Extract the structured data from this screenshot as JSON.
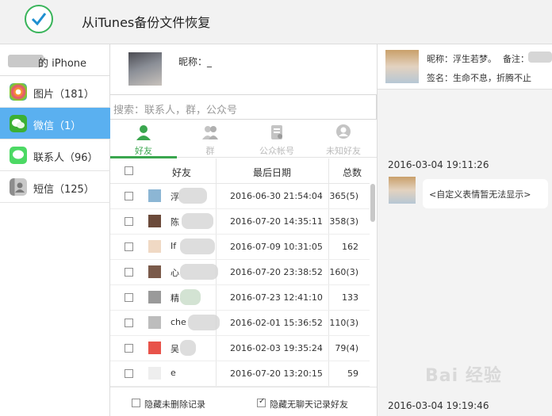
{
  "app": {
    "title": "从iTunes备份文件恢复",
    "icon": "check-logo-icon",
    "accent": "#39b45a"
  },
  "sidebar": {
    "device_label": "的 iPhone",
    "items": [
      {
        "label": "图片（181）",
        "icon": "photos-icon",
        "color": "#f5a623"
      },
      {
        "label": "微信（1）",
        "icon": "wechat-icon",
        "color": "#3cb034",
        "active": true
      },
      {
        "label": "联系人（96）",
        "icon": "messages-icon",
        "color": "#4cd964"
      },
      {
        "label": "短信（125）",
        "icon": "contacts-icon",
        "color": "#9b9b9b"
      }
    ],
    "active_color": "#5ab0f0"
  },
  "account": {
    "nickname_label": "昵称：_"
  },
  "search": {
    "placeholder": "搜索：联系人，群，公众号"
  },
  "tabs": [
    {
      "label": "好友",
      "icon": "friend-icon",
      "active": true
    },
    {
      "label": "群",
      "icon": "group-icon"
    },
    {
      "label": "公众帐号",
      "icon": "official-account-icon"
    },
    {
      "label": "未知好友",
      "icon": "unknown-friend-icon"
    }
  ],
  "table": {
    "headers": [
      "好友",
      "最后日期",
      "总数"
    ],
    "rows": [
      {
        "name": "浮",
        "date": "2016-06-30 21:54:04",
        "total": "365(5)"
      },
      {
        "name": "陈",
        "date": "2016-07-20 14:35:11",
        "total": "358(3)"
      },
      {
        "name": "If",
        "date": "2016-07-09 10:31:05",
        "total": "162"
      },
      {
        "name": "心",
        "date": "2016-07-20 23:38:52",
        "total": "160(3)"
      },
      {
        "name": "精",
        "date": "2016-07-23 12:41:10",
        "total": "133"
      },
      {
        "name": "che",
        "date": "2016-02-01 15:36:52",
        "total": "110(3)"
      },
      {
        "name": "吴",
        "date": "2016-02-03 19:35:24",
        "total": "79(4)"
      },
      {
        "name": "e",
        "date": "2016-07-20 13:20:15",
        "total": "59"
      }
    ]
  },
  "footer": {
    "hide_not_deleted": "隐藏未删除记录",
    "hide_no_chat": "隐藏无聊天记录好友"
  },
  "chat": {
    "profile_nick": "昵称：浮生若梦。",
    "profile_remark": "备注：",
    "profile_sign": "签名：生命不息，折腾不止",
    "time1": "2016-03-04 19:11:26",
    "message1": "<自定义表情暂无法显示>",
    "time2": "2016-03-04 19:19:46"
  },
  "watermark": "Bai 经验"
}
